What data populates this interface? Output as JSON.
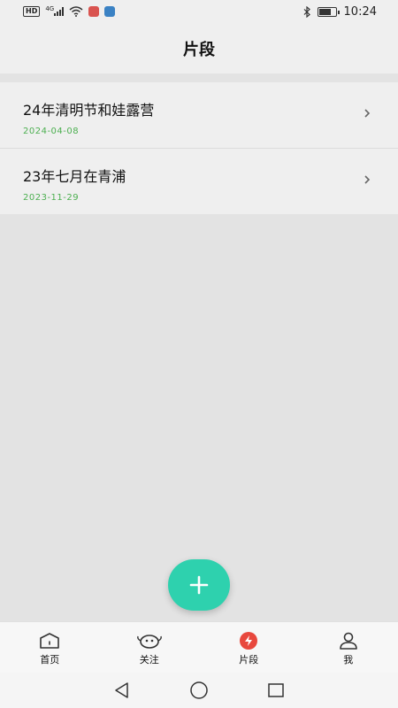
{
  "status_bar": {
    "hd_badge": "HD",
    "network": "4G",
    "time": "10:24",
    "battery_level": 0.75
  },
  "header": {
    "title": "片段"
  },
  "fragments": [
    {
      "title": "24年清明节和娃露营",
      "date": "2024-04-08"
    },
    {
      "title": "23年七月在青浦",
      "date": "2023-11-29"
    }
  ],
  "fab": {
    "icon": "plus-icon",
    "color": "#2ed1ae"
  },
  "tabs": [
    {
      "label": "首页",
      "icon": "home-icon",
      "active": false
    },
    {
      "label": "关注",
      "icon": "follow-icon",
      "active": false
    },
    {
      "label": "片段",
      "icon": "lightning-icon",
      "active": true
    },
    {
      "label": "我",
      "icon": "user-icon",
      "active": false
    }
  ],
  "colors": {
    "accent": "#2ed1ae",
    "date": "#4caf50",
    "active_tab": "#e8483d"
  }
}
